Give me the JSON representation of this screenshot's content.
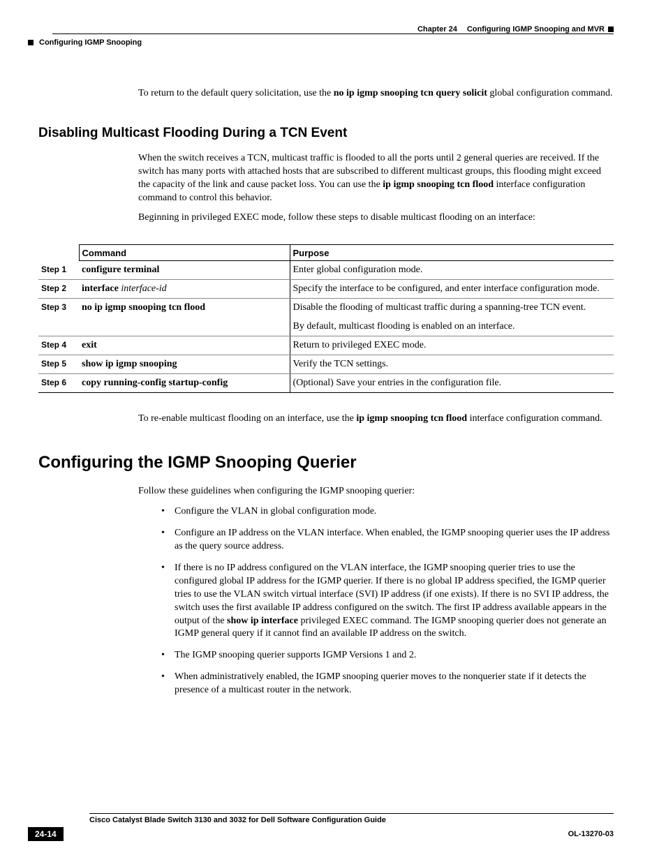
{
  "header": {
    "chapter": "Chapter 24",
    "chapterTitle": "Configuring IGMP Snooping and MVR",
    "section": "Configuring IGMP Snooping"
  },
  "intro": {
    "text_pre": "To return to the default query solicitation, use the ",
    "text_bold": "no ip igmp snooping tcn query solicit",
    "text_post": " global configuration command."
  },
  "h2_1": "Disabling Multicast Flooding During a TCN Event",
  "para1": {
    "pre": "When the switch receives a TCN, multicast traffic is flooded to all the ports until 2 general queries are received. If the switch has many ports with attached hosts that are subscribed to different multicast groups, this flooding might exceed the capacity of the link and cause packet loss. You can use the ",
    "bold": "ip igmp snooping tcn flood",
    "post": " interface configuration command to control this behavior."
  },
  "para2": "Beginning in privileged EXEC mode, follow these steps to disable multicast flooding on an interface:",
  "table": {
    "head": {
      "command": "Command",
      "purpose": "Purpose"
    },
    "rows": [
      {
        "step": "Step 1",
        "cmd_bold": "configure terminal",
        "cmd_ital": "",
        "purpose": "Enter global configuration mode."
      },
      {
        "step": "Step 2",
        "cmd_bold": "interface",
        "cmd_ital": " interface-id",
        "purpose": "Specify the interface to be configured, and enter interface configuration mode."
      },
      {
        "step": "Step 3",
        "cmd_bold": "no ip igmp snooping tcn flood",
        "cmd_ital": "",
        "purpose": "Disable the flooding of multicast traffic during a spanning-tree TCN event.",
        "purpose2": "By default, multicast flooding is enabled on an interface."
      },
      {
        "step": "Step 4",
        "cmd_bold": "exit",
        "cmd_ital": "",
        "purpose": "Return to privileged EXEC mode."
      },
      {
        "step": "Step 5",
        "cmd_bold": "show ip igmp snooping",
        "cmd_ital": "",
        "purpose": "Verify the TCN settings."
      },
      {
        "step": "Step 6",
        "cmd_bold": "copy running-config startup-config",
        "cmd_ital": "",
        "purpose": "(Optional) Save your entries in the configuration file."
      }
    ]
  },
  "para3": {
    "pre": "To re-enable multicast flooding on an interface, use the ",
    "bold": "ip igmp snooping tcn flood",
    "post": " interface configuration command."
  },
  "h1": "Configuring the IGMP Snooping Querier",
  "para4": "Follow these guidelines when configuring the IGMP snooping querier:",
  "bullets": [
    {
      "text": "Configure the VLAN in global configuration mode."
    },
    {
      "text": "Configure an IP address on the VLAN interface. When enabled, the IGMP snooping querier uses the IP address as the query source address."
    },
    {
      "pre": "If there is no IP address configured on the VLAN interface, the IGMP snooping querier tries to use the configured global IP address for the IGMP querier. If there is no global IP address specified, the IGMP querier tries to use the VLAN switch virtual interface (SVI) IP address (if one exists). If there is no SVI IP address, the switch uses the first available IP address configured on the switch. The first IP address available appears in the output of the ",
      "bold": "show ip interface",
      "post": " privileged EXEC command. The IGMP snooping querier does not generate an IGMP general query if it cannot find an available IP address on the switch."
    },
    {
      "text": "The IGMP snooping querier supports IGMP Versions 1 and 2."
    },
    {
      "text": "When administratively enabled, the IGMP snooping querier moves to the nonquerier state if it detects the presence of a multicast router in the network."
    }
  ],
  "footer": {
    "title": "Cisco Catalyst Blade Switch 3130 and 3032 for Dell Software Configuration Guide",
    "page": "24-14",
    "docid": "OL-13270-03"
  }
}
